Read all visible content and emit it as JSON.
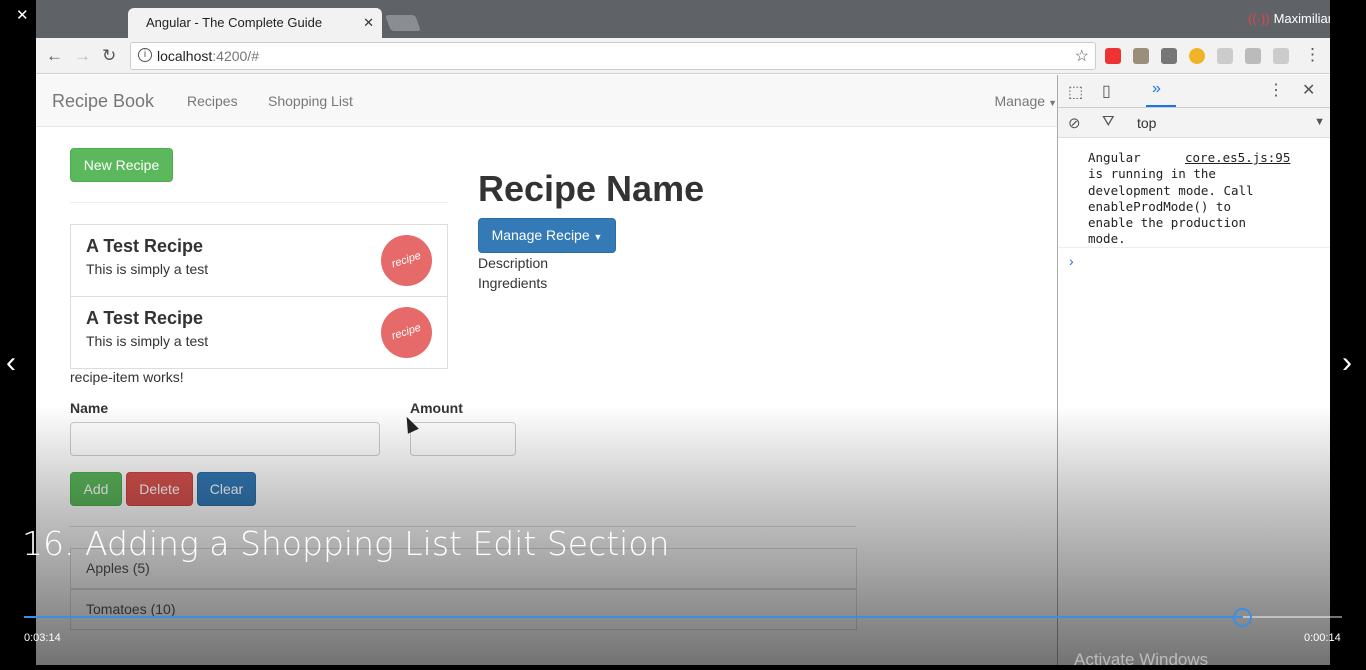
{
  "window": {
    "close": "✕",
    "restore": "⧉",
    "minimize": "—"
  },
  "browser": {
    "tab_title": "Angular - The Complete Guide",
    "tab_close": "✕",
    "user_name": "Maximilian",
    "url_host": "localhost",
    "url_path": ":4200/#"
  },
  "navbar": {
    "brand": "Recipe Book",
    "links": [
      "Recipes",
      "Shopping List"
    ],
    "manage": "Manage"
  },
  "recipes": {
    "new_button": "New Recipe",
    "items": [
      {
        "name": "A Test Recipe",
        "description": "This is simply a test",
        "image_text": "recipe"
      },
      {
        "name": "A Test Recipe",
        "description": "This is simply a test",
        "image_text": "recipe"
      }
    ],
    "works_text": "recipe-item works!"
  },
  "recipe_detail": {
    "title": "Recipe Name",
    "manage_button": "Manage Recipe",
    "description": "Description",
    "ingredients": "Ingredients"
  },
  "shopping_edit": {
    "name_label": "Name",
    "amount_label": "Amount",
    "add": "Add",
    "delete": "Delete",
    "clear": "Clear"
  },
  "shopping_list": {
    "items": [
      "Apples (5)",
      "Tomatoes (10)"
    ]
  },
  "devtools": {
    "context": "top",
    "message": "Angular\nis running in the\ndevelopment mode. Call\nenableProdMode() to\nenable the production\nmode.",
    "source": "core.es5.js:95"
  },
  "video": {
    "title": "16. Adding a Shopping List Edit Section",
    "elapsed": "0:03:14",
    "remaining": "0:00:14",
    "progress": 0.925,
    "watermark": "Activate Windows"
  },
  "colors": {
    "success": "#5cb85c",
    "danger": "#d9534f",
    "primary": "#337ab7",
    "progress": "#3b8fe0"
  }
}
